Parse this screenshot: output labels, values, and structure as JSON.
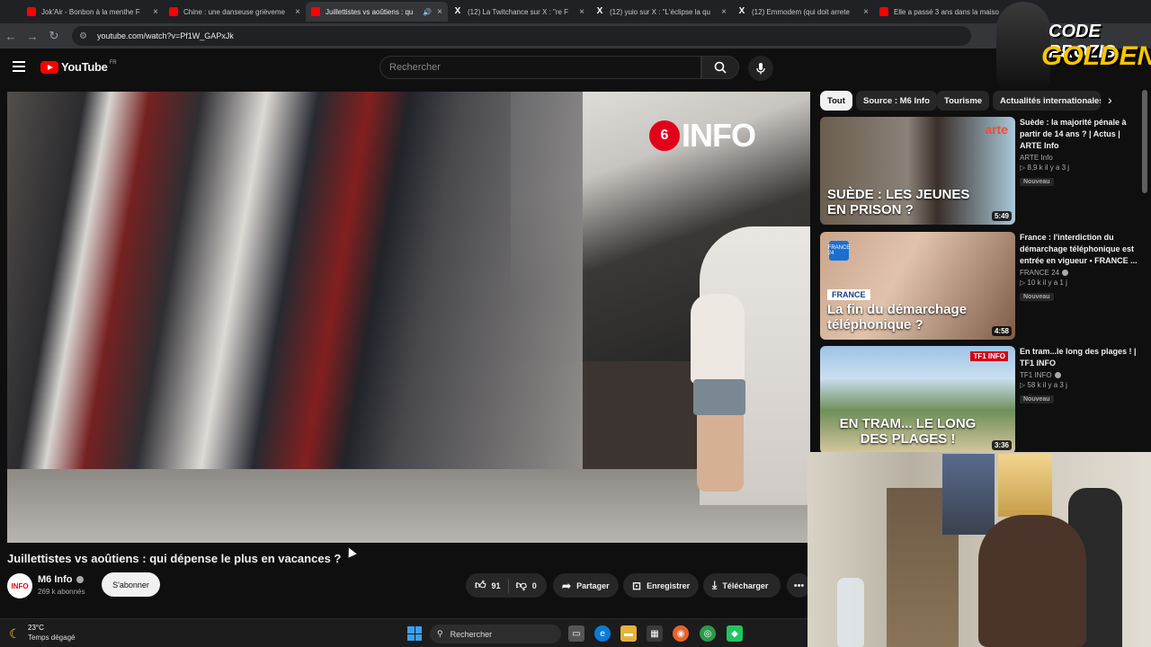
{
  "browser": {
    "tabs": [
      {
        "title": "Jok'Air - Bonbon à la menthe F",
        "icon": "youtube-icon",
        "active": false
      },
      {
        "title": "Chine : une danseuse grièveme",
        "icon": "youtube-icon",
        "active": false
      },
      {
        "title": "Juillettistes vs aoûtiens : qu",
        "icon": "youtube-icon",
        "active": true
      },
      {
        "title": "(12) La Twitchance sur X : \"re F",
        "icon": "x-icon",
        "active": false
      },
      {
        "title": "(12) yuio sur X : \"L'éclipse la qu",
        "icon": "x-icon",
        "active": false
      },
      {
        "title": "(12) Emmodem (qui doit arrete",
        "icon": "x-icon",
        "active": false
      },
      {
        "title": "Elle a passé 3 ans dans la maiso",
        "icon": "youtube-icon",
        "active": false
      }
    ],
    "url": "youtube.com/watch?v=Pf1W_GAPxJk"
  },
  "youtube": {
    "logo_text": "YouTube",
    "country": "FR",
    "search_placeholder": "Rechercher"
  },
  "player": {
    "watermark_m6": "6",
    "watermark_info": "INFO"
  },
  "video": {
    "title": "Juillettistes vs aoûtiens : qui dépense le plus en vacances ?",
    "channel": "M6 Info",
    "channel_avatar_text": "INFO",
    "subscribers": "269 k abonnés",
    "subscribe_label": "S'abonner",
    "likes": "91",
    "dislikes": "0",
    "share_label": "Partager",
    "save_label": "Enregistrer",
    "download_label": "Télécharger",
    "more_label": "•••"
  },
  "chips": [
    "Tout",
    "Source : M6 Info",
    "Tourisme",
    "Actualités internationales"
  ],
  "recommendations": [
    {
      "thumb_caption": "SUÈDE : LES JEUNES EN PRISON ?",
      "thumb_brand": "arte",
      "duration": "5:49",
      "title": "Suède : la majorité pénale à partir de 14 ans ? | Actus | ARTE Info",
      "channel": "ARTE Info",
      "stats": "▷ 8,9 k  il y a 3 j",
      "badge": "Nouveau"
    },
    {
      "thumb_tag": "FRANCE",
      "thumb_caption": "La fin du démarchage téléphonique ?",
      "thumb_brand": "FRANCE 24",
      "duration": "4:58",
      "title": "France : l'interdiction du démarchage téléphonique est entrée en vigueur • FRANCE ...",
      "channel": "FRANCE 24",
      "stats": "▷ 10 k  il y a 1 j",
      "badge": "Nouveau"
    },
    {
      "thumb_caption": "EN TRAM... LE LONG DES PLAGES !",
      "thumb_brand": "TF1 INFO",
      "duration": "3:36",
      "title": "En tram...le long des plages ! | TF1 INFO",
      "channel": "TF1 INFO",
      "stats": "▷ 58 k  il y a 3 j",
      "badge": "Nouveau"
    }
  ],
  "overlay": {
    "line1": "CODE PROZIS",
    "line2": "GOLDENG"
  },
  "taskbar": {
    "temperature": "23°C",
    "condition": "Temps dégagé",
    "search_label": "Rechercher"
  },
  "colors": {
    "youtube_red": "#ff0000",
    "background": "#0f0f0f",
    "m6_red": "#e3001b",
    "overlay_gold": "#f7c600"
  }
}
